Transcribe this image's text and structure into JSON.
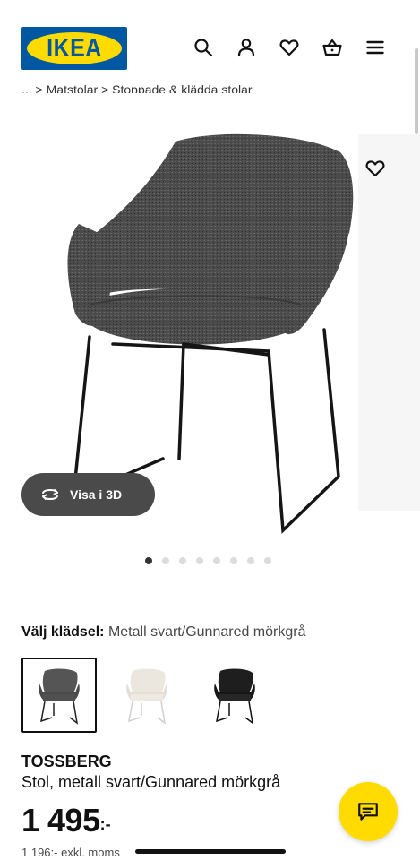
{
  "header": {
    "logo_text": "IKEA",
    "icons": [
      "search-icon",
      "profile-icon",
      "heart-icon",
      "basket-icon",
      "menu-icon"
    ]
  },
  "breadcrumb": {
    "text": "... > Matstolar > Stoppade & klädda stolar"
  },
  "product_image": {
    "view3d_label": "Visa i 3D",
    "carousel_count": 8,
    "carousel_active": 0
  },
  "variant": {
    "label": "Välj klädsel:",
    "value": "Metall svart/Gunnared mörkgrå",
    "swatches": [
      "dark-grey-chair",
      "white-chair",
      "black-chair"
    ],
    "selected": 0
  },
  "product": {
    "name": "TOSSBERG",
    "description": "Stol, metall svart/Gunnared mörkgrå",
    "price_main": "1 495",
    "price_suffix": ":-",
    "price_ex_vat": "1 196:- exkl. moms"
  },
  "colors": {
    "ikea_blue": "#0058a3",
    "ikea_yellow": "#ffdb00",
    "chip_dark": "#4a4a4a"
  }
}
